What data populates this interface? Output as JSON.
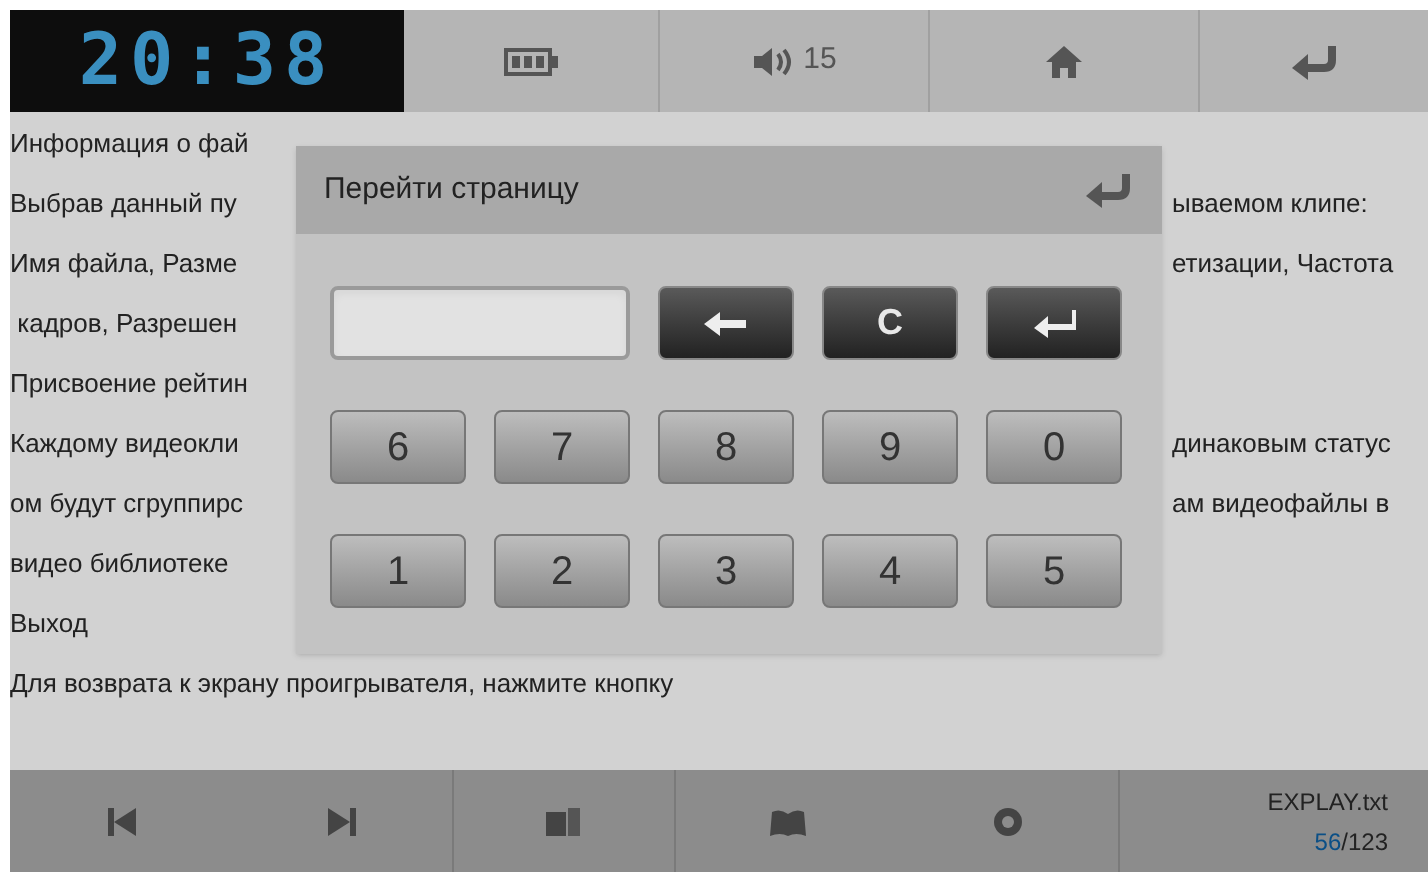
{
  "top_bar": {
    "clock": "20:38",
    "volume": "15"
  },
  "text_lines": [
    {
      "left": "Информация о фай"
    },
    {
      "left": "Выбрав данный пу",
      "right": "ываемом клипе:"
    },
    {
      "left": "Имя файла, Разме",
      "right": "етизации, Частота"
    },
    {
      "left": " кадров, Разрешен"
    },
    {
      "left": "Присвоение рейтин"
    },
    {
      "left": "Каждому видеокли",
      "right": "динаковым статус"
    },
    {
      "left": "ом будут сгруппирс",
      "right": "ам видеофайлы в"
    },
    {
      "left": "видео библиотеке"
    },
    {
      "left": "Выход"
    },
    {
      "left": "Для возврата к экрану проигрывателя, нажмите кнопку"
    }
  ],
  "dialog": {
    "title": "Перейти страницу",
    "keys": [
      {
        "kind": "backspace"
      },
      {
        "kind": "clear",
        "label": "C"
      },
      {
        "kind": "enter"
      },
      {
        "kind": "digit",
        "label": "6"
      },
      {
        "kind": "digit",
        "label": "7"
      },
      {
        "kind": "digit",
        "label": "8"
      },
      {
        "kind": "digit",
        "label": "9"
      },
      {
        "kind": "digit",
        "label": "0"
      },
      {
        "kind": "digit",
        "label": "1"
      },
      {
        "kind": "digit",
        "label": "2"
      },
      {
        "kind": "digit",
        "label": "3"
      },
      {
        "kind": "digit",
        "label": "4"
      },
      {
        "kind": "digit",
        "label": "5"
      }
    ]
  },
  "bottom_bar": {
    "file_name": "EXPLAY.txt",
    "page_current": "56",
    "page_rest": "/123"
  }
}
